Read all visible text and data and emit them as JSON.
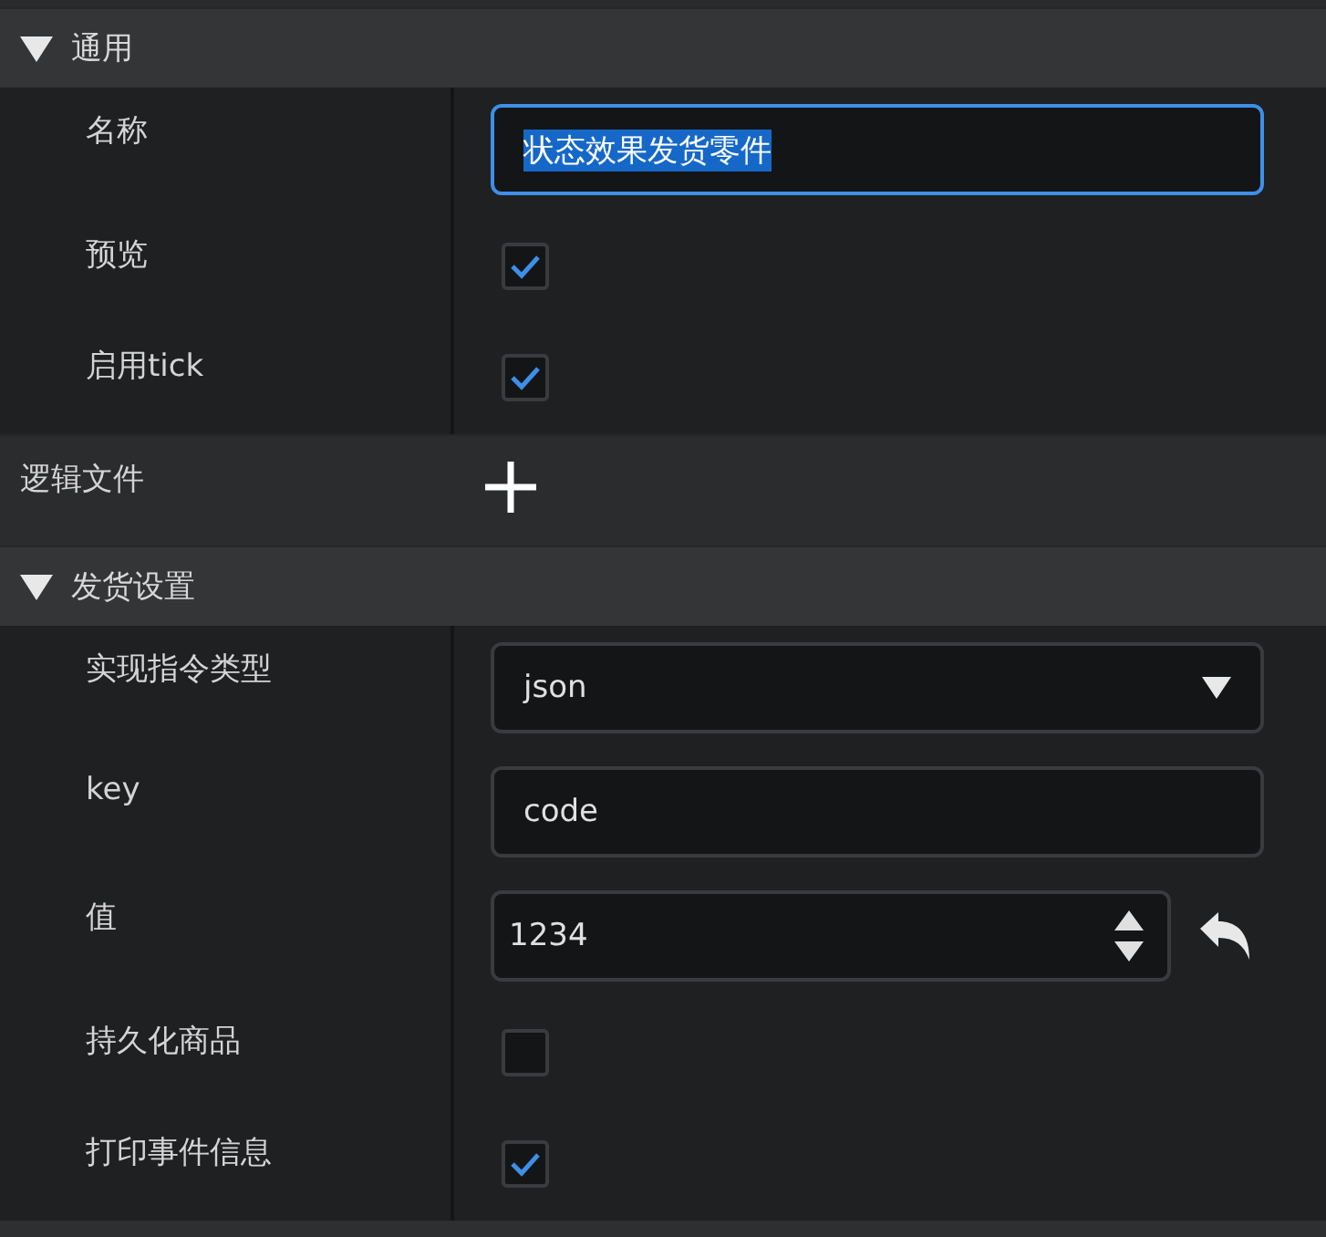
{
  "sections": [
    {
      "kind": "group",
      "title": "通用",
      "expanded": true,
      "rows": [
        {
          "kind": "text",
          "label": "名称",
          "value": "状态效果发货零件",
          "focused": true,
          "text_selected": true
        },
        {
          "kind": "checkbox",
          "label": "预览",
          "checked": true
        },
        {
          "kind": "checkbox",
          "label": "启用tick",
          "checked": true
        }
      ]
    },
    {
      "kind": "action",
      "title": "逻辑文件"
    },
    {
      "kind": "group",
      "title": "发货设置",
      "expanded": true,
      "rows": [
        {
          "kind": "select",
          "label": "实现指令类型",
          "value": "json"
        },
        {
          "kind": "text",
          "label": "key",
          "value": "code",
          "focused": false,
          "text_selected": false
        },
        {
          "kind": "number",
          "label": "值",
          "value": "1234"
        },
        {
          "kind": "checkbox",
          "label": "持久化商品",
          "checked": false
        },
        {
          "kind": "checkbox",
          "label": "打印事件信息",
          "checked": true
        }
      ]
    }
  ]
}
